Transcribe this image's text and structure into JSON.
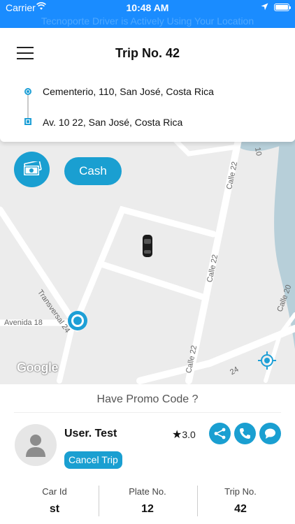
{
  "status_bar": {
    "carrier": "Carrier",
    "time": "10:48 AM",
    "banner": "Tecnoporte Driver is Actively Using Your Location"
  },
  "header": {
    "title": "Trip No. 42",
    "pickup": "Cementerio, 110, San José, Costa Rica",
    "dropoff": "Av. 10 22, San José, Costa Rica"
  },
  "map": {
    "streets": [
      "Calle 22",
      "Calle 22",
      "Calle 22",
      "Calle 20",
      "Transversal 24",
      "Avenida 18",
      "10",
      "24"
    ],
    "attribution": "Google"
  },
  "payment": {
    "method_label": "Cash",
    "icon": "money-icon"
  },
  "panel": {
    "promo_label": "Have Promo Code ?",
    "user_name": "User. Test",
    "rating": "3.0",
    "cancel_label": "Cancel Trip",
    "stats": [
      {
        "label": "Car Id",
        "value": "st"
      },
      {
        "label": "Plate No.",
        "value": "12"
      },
      {
        "label": "Trip No.",
        "value": "42"
      }
    ]
  },
  "colors": {
    "accent": "#1a9fd1",
    "status_bar": "#1a8cff",
    "river": "#b7cfd9"
  }
}
